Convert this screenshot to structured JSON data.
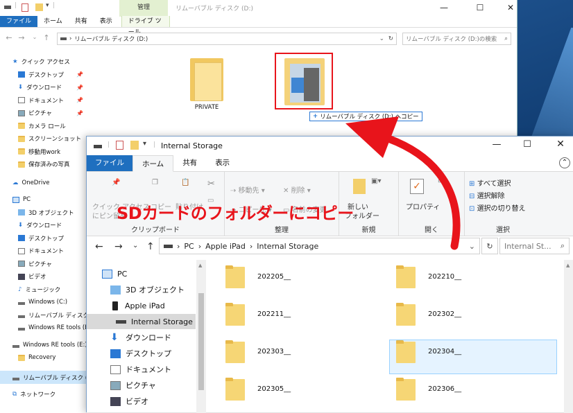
{
  "win1": {
    "title": "リムーバブル ディスク (D:)",
    "ctx_group": "管理",
    "tabs": [
      "ファイル",
      "ホーム",
      "共有",
      "表示",
      "ドライブ ツール"
    ],
    "address": "リムーバブル ディスク (D:)",
    "search_placeholder": "リムーバブル ディスク (D:)の検索",
    "sidebar": [
      {
        "label": "クイック アクセス",
        "icon": "star-icon"
      },
      {
        "label": "デスクトップ",
        "icon": "desktop-icon",
        "pin": "📌"
      },
      {
        "label": "ダウンロード",
        "icon": "download-icon",
        "pin": "📌"
      },
      {
        "label": "ドキュメント",
        "icon": "document-icon",
        "pin": "📌"
      },
      {
        "label": "ピクチャ",
        "icon": "picture-icon",
        "pin": "📌"
      },
      {
        "label": "カメラ ロール",
        "icon": "folder-icon"
      },
      {
        "label": "スクリーンショット",
        "icon": "folder-icon"
      },
      {
        "label": "移動用work",
        "icon": "folder-icon"
      },
      {
        "label": "保存済みの写真",
        "icon": "folder-icon"
      },
      {
        "label": "OneDrive",
        "icon": "cloud-icon"
      },
      {
        "label": "PC",
        "icon": "pc-icon"
      },
      {
        "label": "3D オブジェクト",
        "icon": "cube-icon"
      },
      {
        "label": "ダウンロード",
        "icon": "download-icon"
      },
      {
        "label": "デスクトップ",
        "icon": "desktop-icon"
      },
      {
        "label": "ドキュメント",
        "icon": "document-icon"
      },
      {
        "label": "ピクチャ",
        "icon": "picture-icon"
      },
      {
        "label": "ビデオ",
        "icon": "video-icon"
      },
      {
        "label": "ミュージック",
        "icon": "music-icon"
      },
      {
        "label": "Windows (C:)",
        "icon": "drive-icon"
      },
      {
        "label": "リムーバブル ディスク (D:",
        "icon": "drive-icon"
      },
      {
        "label": "Windows RE tools (E:",
        "icon": "drive-icon"
      },
      {
        "label": "Windows RE tools (E:)",
        "icon": "drive-icon"
      },
      {
        "label": "Recovery",
        "icon": "folder-icon"
      },
      {
        "label": "リムーバブル ディスク (D:)",
        "icon": "drive-icon"
      },
      {
        "label": "ネットワーク",
        "icon": "network-icon"
      }
    ],
    "folders": [
      {
        "label": "PRIVATE"
      }
    ],
    "drag_tooltip": "リムーバブル ディスク (D:) へコピー",
    "drag_plus": "+"
  },
  "win2": {
    "title": "Internal Storage",
    "tabs": [
      "ファイル",
      "ホーム",
      "共有",
      "表示"
    ],
    "ribbon": {
      "pin_label_1": "クイック アクセス",
      "pin_label_2": "にピン留め",
      "copy_label": "コピー",
      "paste_label": "貼り付け",
      "clipboard_group": "クリップボード",
      "move_to": "移動先",
      "delete": "削除",
      "copy_to": "コピー先",
      "rename": "名前の変更",
      "organize_group": "整理",
      "new_folder_1": "新しい",
      "new_folder_2": "フォルダー",
      "new_group": "新規",
      "properties": "プロパティ",
      "open_group": "開く",
      "select_all": "すべて選択",
      "select_none": "選択解除",
      "invert_selection": "選択の切り替え",
      "select_group": "選択"
    },
    "breadcrumb": [
      "PC",
      "Apple iPad",
      "Internal Storage"
    ],
    "search_placeholder": "Internal St...",
    "tree": [
      {
        "label": "PC",
        "icon": "pc-icon"
      },
      {
        "label": "3D オブジェクト",
        "icon": "cube-icon"
      },
      {
        "label": "Apple iPad",
        "icon": "ipad-icon"
      },
      {
        "label": "Internal Storage",
        "icon": "storage-icon"
      },
      {
        "label": "ダウンロード",
        "icon": "download-icon"
      },
      {
        "label": "デスクトップ",
        "icon": "desktop-icon"
      },
      {
        "label": "ドキュメント",
        "icon": "document-icon"
      },
      {
        "label": "ピクチャ",
        "icon": "picture-icon"
      },
      {
        "label": "ビデオ",
        "icon": "video-icon"
      }
    ],
    "folders": [
      "202205__",
      "202210__",
      "202211__",
      "202302__",
      "202303__",
      "202304__",
      "202305__",
      "202306__"
    ]
  },
  "annotation": "SDカードのフォルダーにコピー",
  "colors": {
    "accent": "#1f6fbf",
    "annotation_red": "#e8141b",
    "folder": "#f6d675"
  }
}
